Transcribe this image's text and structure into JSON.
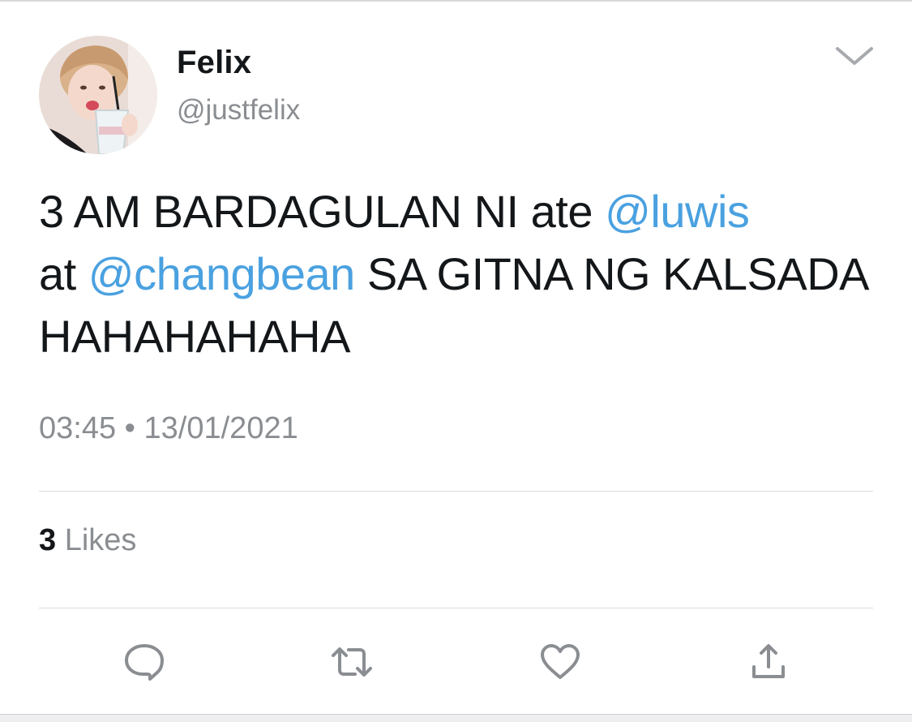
{
  "author": {
    "display_name": "Felix",
    "handle": "@justfelix"
  },
  "tweet": {
    "segments": {
      "s1": "3 AM BARDAGULAN NI ate ",
      "mention1": "@luwis",
      "s2": " at ",
      "mention2": "@changbean",
      "s3": " SA GITNA NG KALSADA HAHAHAHAHA"
    },
    "time": "03:45",
    "separator": "•",
    "date": "13/01/2021"
  },
  "stats": {
    "likes_count": "3",
    "likes_label": "Likes"
  },
  "icons": {
    "menu": "chevron-down-icon",
    "reply": "reply-icon",
    "retweet": "retweet-icon",
    "like": "heart-icon",
    "share": "share-icon"
  },
  "colors": {
    "mention": "#4aa1e0",
    "secondary_text": "#8a8d91",
    "primary_text": "#14171a",
    "divider": "#dcdcdc"
  }
}
